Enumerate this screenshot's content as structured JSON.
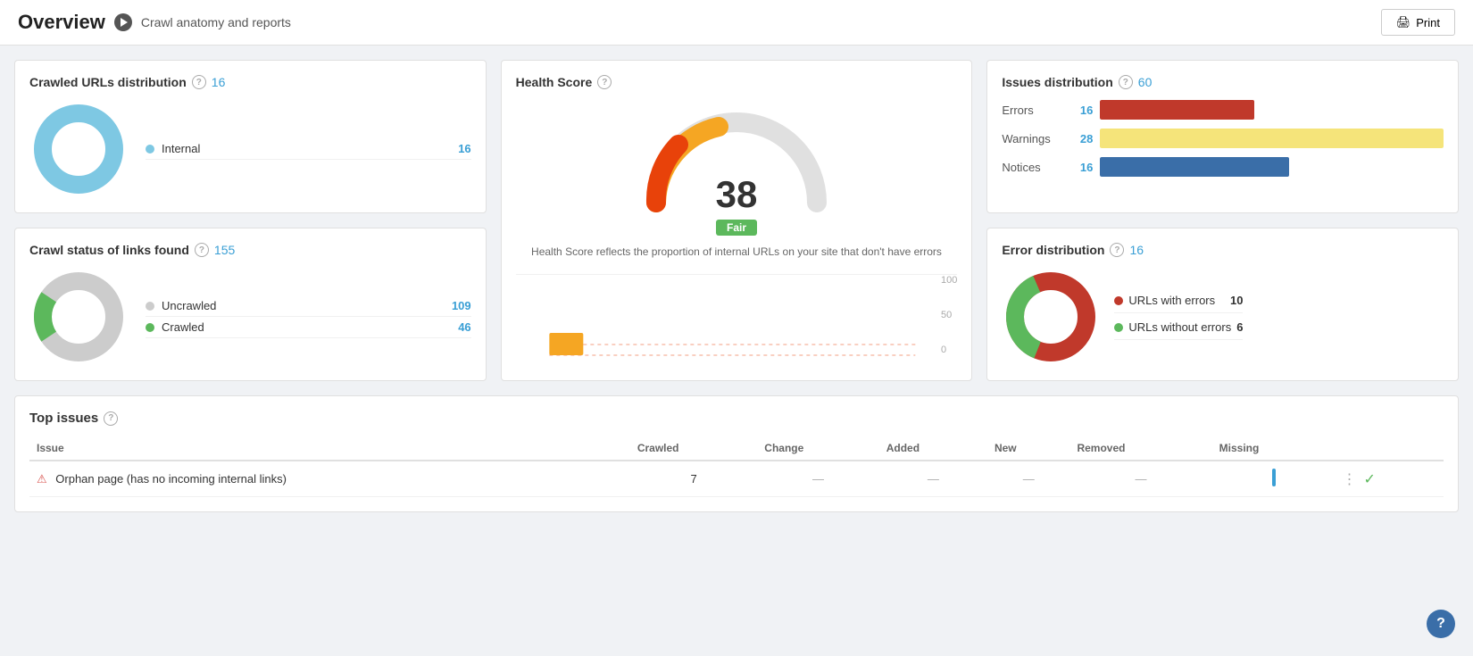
{
  "header": {
    "title": "Overview",
    "breadcrumb": "Crawl anatomy and reports",
    "print_label": "Print"
  },
  "crawled_urls": {
    "title": "Crawled URLs distribution",
    "help": "?",
    "count": 16,
    "items": [
      {
        "label": "Internal",
        "color": "#7ec8e3",
        "value": 16
      }
    ]
  },
  "crawl_status": {
    "title": "Crawl status of links found",
    "help": "?",
    "count": 155,
    "items": [
      {
        "label": "Uncrawled",
        "color": "#ccc",
        "value": 109
      },
      {
        "label": "Crawled",
        "color": "#5cb85c",
        "value": 46
      }
    ]
  },
  "health_score": {
    "title": "Health Score",
    "help": "?",
    "score": 38,
    "badge": "Fair",
    "description": "Health Score reflects the proportion of internal URLs on your site that don't have errors",
    "chart_labels": {
      "top": "100",
      "mid": "50",
      "bottom": "0"
    }
  },
  "issues_distribution": {
    "title": "Issues distribution",
    "help": "?",
    "count": 60,
    "items": [
      {
        "label": "Errors",
        "count": 16,
        "color": "#c0392b",
        "bar_width": "45%"
      },
      {
        "label": "Warnings",
        "count": 28,
        "color": "#f5e47a",
        "bar_width": "100%"
      },
      {
        "label": "Notices",
        "count": 16,
        "color": "#3a6ea8",
        "bar_width": "55%"
      }
    ]
  },
  "error_distribution": {
    "title": "Error distribution",
    "help": "?",
    "count": 16,
    "items": [
      {
        "label": "URLs with errors",
        "color": "#c0392b",
        "value": 10
      },
      {
        "label": "URLs without errors",
        "color": "#5cb85c",
        "value": 6
      }
    ]
  },
  "top_issues": {
    "title": "Top issues",
    "help": "?",
    "columns": [
      "Issue",
      "Crawled",
      "Change",
      "Added",
      "New",
      "Removed",
      "Missing"
    ],
    "rows": [
      {
        "icon": "error",
        "issue": "Orphan page (has no incoming internal links)",
        "crawled": 7,
        "change": "—",
        "added": "—",
        "new": "—",
        "removed": "—",
        "missing": "bar"
      }
    ]
  }
}
